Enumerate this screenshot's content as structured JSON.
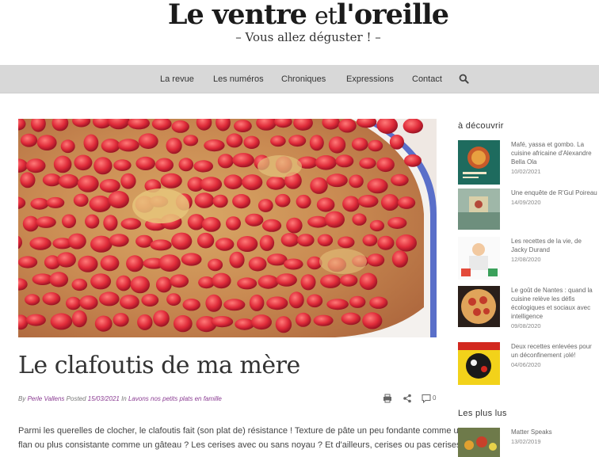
{
  "site": {
    "title_a": "Le ventre",
    "title_b": "et",
    "title_c": "l'oreille",
    "tagline": "– Vous allez déguster ! –"
  },
  "nav": {
    "items": [
      "La revue",
      "Les numéros",
      "Chroniques",
      "Expressions",
      "Contact"
    ],
    "search_icon": "search-icon"
  },
  "post": {
    "title": "Le clafoutis de ma mère",
    "by_label": "By",
    "author": "Perle Vallens",
    "posted_label": "Posted",
    "date": "15/03/2021",
    "in_label": "In",
    "category": "Lavons nos petits plats en famille",
    "comment_count": "0",
    "excerpt_line1": "Parmi les querelles de clocher, le clafoutis fait (son plat de) résistance ! Texture de pâte un peu fondante comme un",
    "excerpt_line2": "flan ou plus consistante comme un gâteau ? Les cerises avec ou sans noyau ? Et d'ailleurs, cerises ou pas cerises, et"
  },
  "sidebar": {
    "discover_title": "à découvrir",
    "discover": [
      {
        "title": "Mafé, yassa et gombo. La cuisine africaine d'Alexandre Bella Ola",
        "date": "10/02/2021"
      },
      {
        "title": "Une enquête de R'Gul Poireau",
        "date": "14/09/2020"
      },
      {
        "title": "Les recettes de la vie, de Jacky Durand",
        "date": "12/08/2020"
      },
      {
        "title": "Le goût de Nantes : quand la cuisine relève les défis écologiques et sociaux avec intelligence",
        "date": "09/08/2020"
      },
      {
        "title": "Deux recettes enlevées pour un déconfinement ¡olé!",
        "date": "04/06/2020"
      }
    ],
    "popular_title": "Les plus lus",
    "popular": [
      {
        "title": "Matter Speaks",
        "date": "13/02/2019"
      }
    ]
  }
}
